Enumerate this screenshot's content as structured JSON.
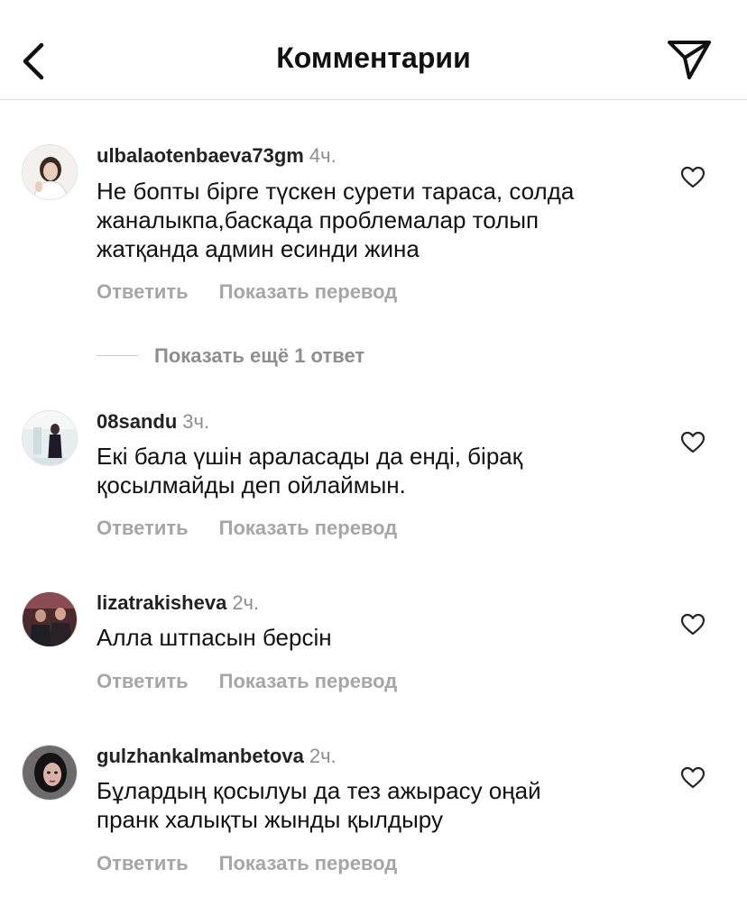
{
  "header": {
    "title": "Комментарии"
  },
  "comments": [
    {
      "username": "ulbalaotenbaeva73gm",
      "time": "4ч.",
      "lines": [
        "Не бопты бірге түскен сурети тараса, солда",
        "жаналыкпа,баскада  проблемалар толып",
        "жатқанда админ есинди жина"
      ],
      "reply_label": "Ответить",
      "translate_label": "Показать перевод"
    },
    {
      "username": "08sandu",
      "time": "3ч.",
      "lines": [
        "Екі бала үшін араласады да  енді, бірақ",
        "қосылмайды деп ойлаймын."
      ],
      "reply_label": "Ответить",
      "translate_label": "Показать перевод"
    },
    {
      "username": "lizatrakisheva",
      "time": "2ч.",
      "lines": [
        "Алла штпасын берсін"
      ],
      "reply_label": "Ответить",
      "translate_label": "Показать перевод"
    },
    {
      "username": "gulzhankalmanbetova",
      "time": "2ч.",
      "lines": [
        "Бұлардың қосылуы да тез ажырасу оңай",
        "пранк халықты жынды қылдыру"
      ],
      "reply_label": "Ответить",
      "translate_label": "Показать перевод"
    }
  ],
  "more_replies_label": "Показать ещё 1 ответ",
  "colors": {
    "text": "#111111",
    "meta": "#8e8e8e",
    "action": "#a6a6a6",
    "divider": "#dcdcdc"
  },
  "icons": [
    "back-chevron-icon",
    "send-icon",
    "heart-icon"
  ]
}
